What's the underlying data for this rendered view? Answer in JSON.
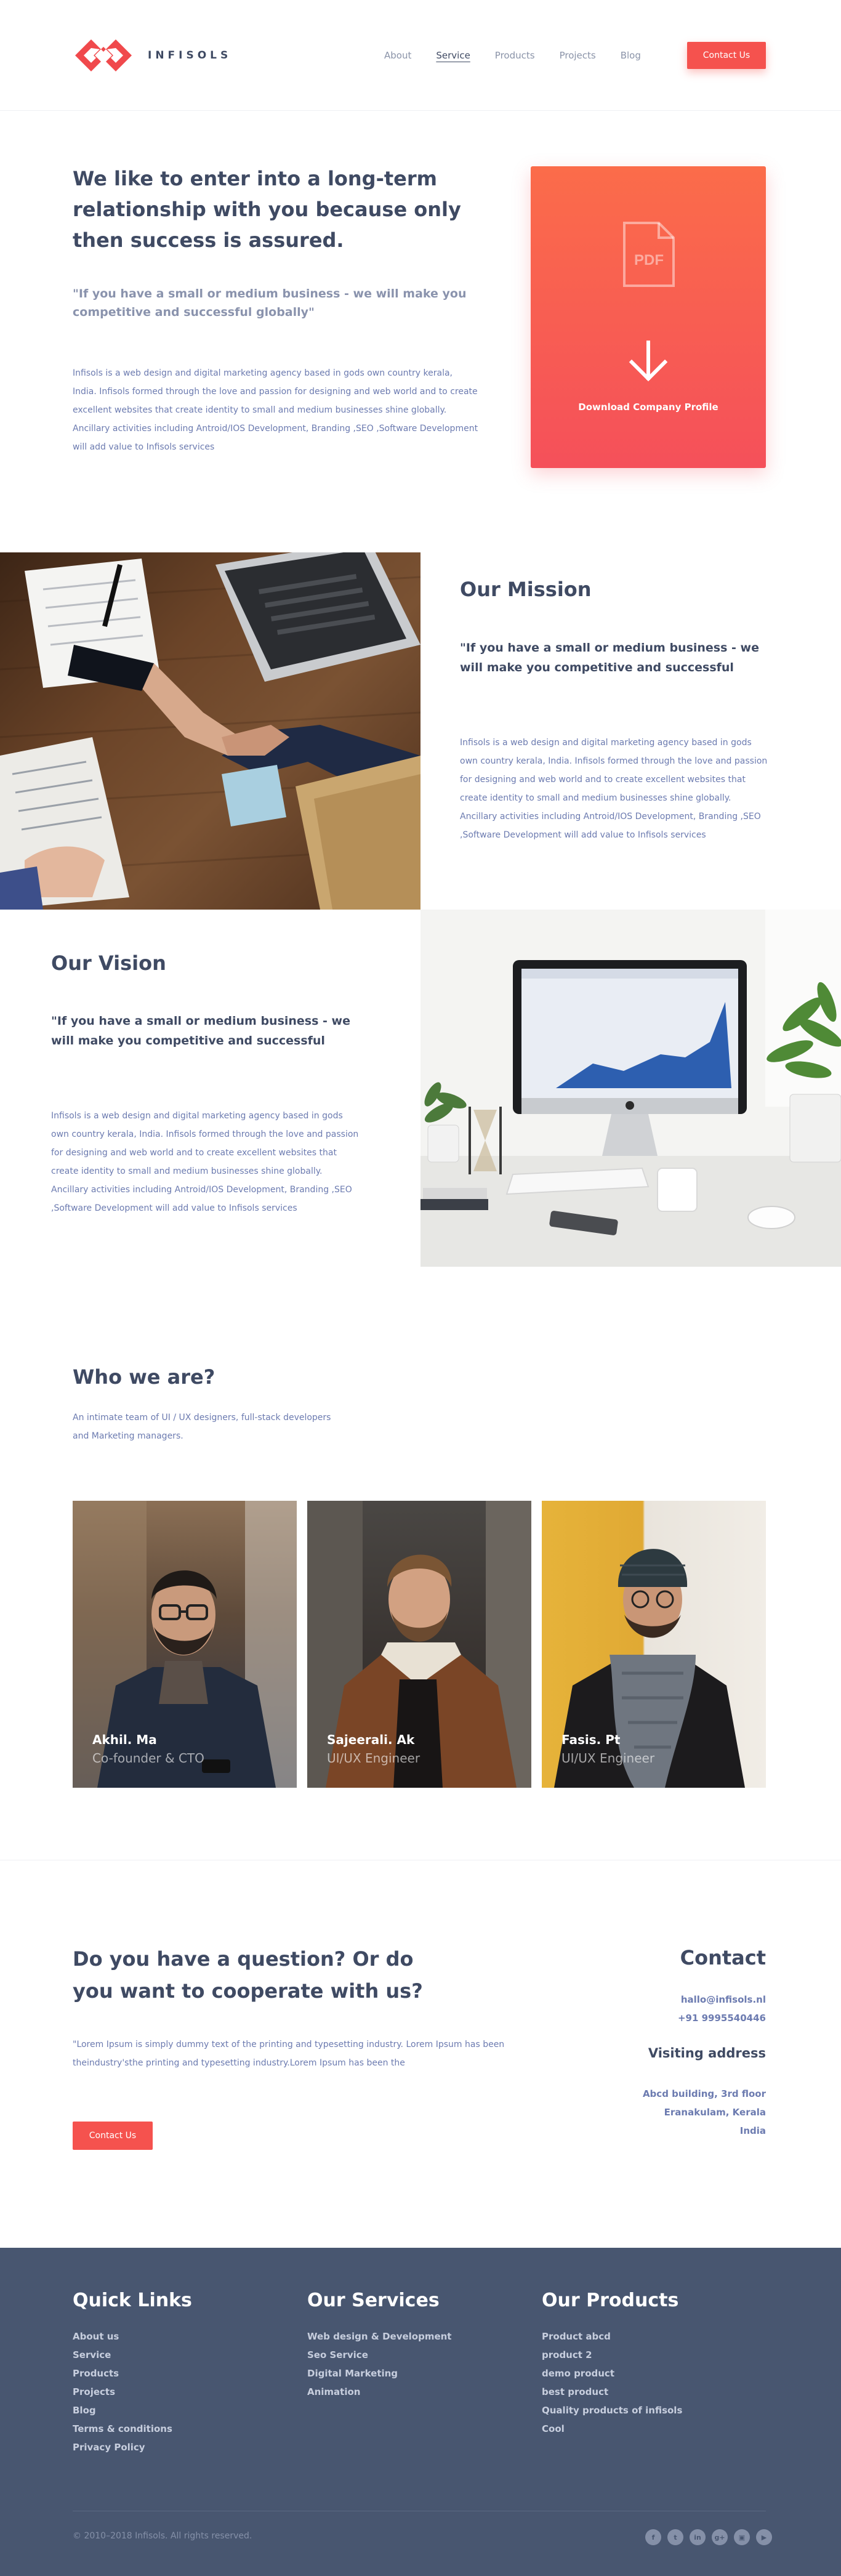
{
  "header": {
    "brand": "INFISOLS",
    "nav": [
      {
        "label": "About",
        "active": false
      },
      {
        "label": "Service",
        "active": true
      },
      {
        "label": "Products",
        "active": false
      },
      {
        "label": "Projects",
        "active": false
      },
      {
        "label": "Blog",
        "active": false
      }
    ],
    "cta_label": "Contact Us",
    "accent_color": "#f5524e"
  },
  "intro": {
    "title": "We like to enter into a long-term relationship with you because only then success is assured.",
    "quote": "\"If you have a small or medium business - we will make you competitive and successful globally\"",
    "body": "Infisols is a web design and digital marketing agency based in gods own country kerala, India. Infisols formed through the love and passion for designing and web world and to create excellent websites that create identity to small and medium businesses shine globally. Ancillary activities including Antroid/IOS Development, Branding ,SEO ,Software Development will add value to Infisols services",
    "download": {
      "icon_label": "PDF",
      "label": "Download Company Profile"
    }
  },
  "mission": {
    "title": "Our Mission",
    "quote": "\"If you have a small or medium business - we will make you competitive and successful",
    "body": "Infisols is a web design and digital marketing agency based in gods own country kerala, India. Infisols formed through the love and passion for designing and web world and to create excellent websites that create identity to small and medium businesses shine globally. Ancillary activities including Antroid/IOS Development, Branding ,SEO ,Software Development will add value to Infisols services"
  },
  "vision": {
    "title": "Our Vision",
    "quote": "\"If you have a small or medium business - we will make you competitive and successful",
    "body": "Infisols is a web design and digital marketing agency based in gods own country kerala, India. Infisols formed through the love and passion for designing and web world and to create excellent websites that create identity to small and medium businesses shine globally. Ancillary activities including Antroid/IOS Development, Branding ,SEO ,Software Development will add value to Infisols services"
  },
  "team": {
    "title": "Who we are?",
    "intro": "An intimate team of UI / UX designers, full-stack developers and Marketing managers.",
    "members": [
      {
        "name": "Akhil. Ma",
        "role": "Co-founder & CTO"
      },
      {
        "name": "Sajeerali. Ak",
        "role": "UI/UX Engineer"
      },
      {
        "name": "Fasis. Pt",
        "role": "UI/UX Engineer"
      }
    ]
  },
  "contact": {
    "question": "Do you have a question? Or do you want to cooperate with us?",
    "body": "\"Lorem Ipsum is simply dummy text of the printing and typesetting industry. Lorem Ipsum has been theindustry'sthe printing and typesetting industry.Lorem Ipsum has been the",
    "button_label": "Contact Us",
    "heading": "Contact",
    "email": "hallo@infisols.nl",
    "phone": "+91  9995540446",
    "visiting_heading": "Visiting address",
    "address": [
      "Abcd building, 3rd floor",
      "Eranakulam, Kerala",
      "India"
    ]
  },
  "footer": {
    "quick_links": {
      "heading": "Quick Links",
      "items": [
        "About us",
        "Service",
        "Products",
        "Projects",
        "Blog",
        "Terms & conditions",
        "Privacy Policy"
      ]
    },
    "services": {
      "heading": "Our Services",
      "items": [
        "Web design & Development",
        "Seo Service",
        "Digital Marketing",
        "Animation"
      ]
    },
    "products": {
      "heading": "Our Products",
      "items": [
        "Product abcd",
        "product 2",
        "demo product",
        "best product",
        "Quality products of infisols",
        "Cool"
      ]
    },
    "copyright": "©  2010–2018 Infisols. All rights reserved.",
    "socials": [
      {
        "icon": "facebook-icon",
        "glyph": "f"
      },
      {
        "icon": "twitter-icon",
        "glyph": "t"
      },
      {
        "icon": "linkedin-icon",
        "glyph": "in"
      },
      {
        "icon": "google-plus-icon",
        "glyph": "g+"
      },
      {
        "icon": "instagram-icon",
        "glyph": "▣"
      },
      {
        "icon": "youtube-icon",
        "glyph": "▶"
      }
    ]
  }
}
